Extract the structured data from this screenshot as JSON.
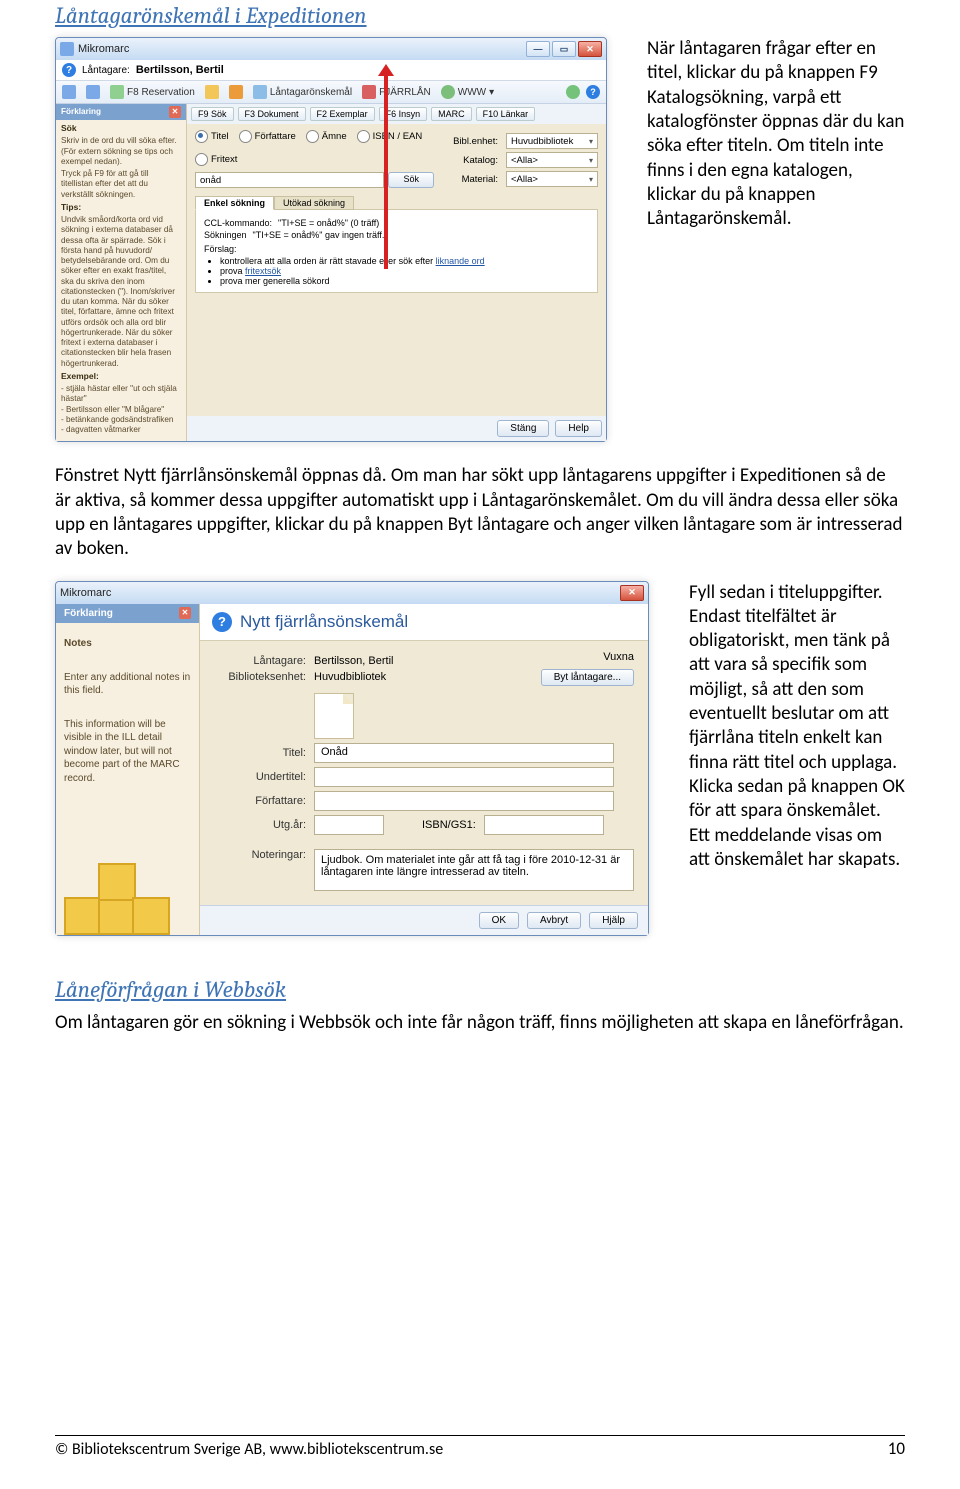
{
  "heading1": "Låntagarönskemål i Expeditionen",
  "intro_text": "När låntagaren frågar efter en titel, klickar du på knappen F9 Katalogsökning, varpå ett katalogfönster öppnas där du kan söka efter titeln. Om titeln inte finns i den egna katalogen, klickar du på knappen Låntagarönskemål.",
  "mm_win": {
    "title": "Mikromarc",
    "borrower_label": "Låntagare:",
    "borrower_name": "Bertilsson, Bertil",
    "toolbar": {
      "back": "",
      "fwd": "",
      "reservation": "F8 Reservation",
      "lock": "",
      "pencil": "",
      "lno": "Låntagarönskemål",
      "fjarrlan": "FJÄRRLÅN",
      "www": "WWW",
      "help": ""
    },
    "side": {
      "head": "Förklaring",
      "sok": "Sök",
      "sok_text": "Skriv in de ord du vill söka efter. (För extern sökning se tips och exempel nedan).",
      "f9": "Tryck på F9 för att gå till titellistan efter det att du verkställt sökningen.",
      "tips_head": "Tips:",
      "tips": "Undvik småord/korta ord vid sökning i externa databaser då dessa ofta är spärrade. Sök i första hand på huvudord/ betydelsebärande ord. Om du söker efter en exakt fras/titel, ska du skriva den inom citationstecken (\"). Inom/skriver du utan komma. När du söker titel, författare, ämne och fritext utförs ordsök och alla ord blir högertrunkerade. När du söker fritext i externa databaser i citationstecken blir hela frasen högertrunkerad.",
      "ex_head": "Exempel:",
      "ex": "- stjäla hästar eller \"ut och stjäla hästar\"\n- Bertilsson eller \"M blågare\"\n- betänkande godsändstrafiken\n- dagvatten våtmarker"
    },
    "fkeys": [
      "F9 Sök",
      "F3 Dokument",
      "F2 Exemplar",
      "F6 Insyn",
      "MARC",
      "F10 Länkar"
    ],
    "radios": {
      "titel": "Titel",
      "forfattare": "Författare",
      "amne": "Ämne",
      "isbn": "ISBN / EAN",
      "fritext": "Fritext"
    },
    "filters": {
      "biblenhet_lbl": "Bibl.enhet:",
      "biblenhet_val": "Huvudbibliotek",
      "katalog_lbl": "Katalog:",
      "katalog_val": "<Alla>",
      "material_lbl": "Material:",
      "material_val": "<Alla>"
    },
    "search_value": "onåd",
    "search_btn": "Sök",
    "tabs": {
      "enkel": "Enkel sökning",
      "utokad": "Utökad sökning"
    },
    "ccl_lbl": "CCL-kommando:",
    "ccl_val": "\"TI+SE = onåd%\" (0 träff)",
    "hits_lbl": "Sökningen",
    "hits_val": "\"TI+SE = onåd%\" gav ingen träff.",
    "forslag_lbl": "Förslag:",
    "forslag_1": "kontrollera att alla orden är rätt stavade eller sök efter",
    "forslag_link1": "liknande ord",
    "forslag_2": "prova",
    "forslag_link2": "fritextsök",
    "forslag_3": "prova mer generella sökord",
    "btn_stang": "Stäng",
    "btn_help": "Help"
  },
  "mid_para": "Fönstret Nytt fjärrlånsönskemål öppnas då. Om man har sökt upp låntagarens uppgifter i Expeditionen så de är aktiva, så kommer dessa uppgifter automatiskt upp i Låntagarönskemålet. Om du vill ändra dessa eller söka upp en låntagares uppgifter, klickar du på knappen Byt låntagare och anger vilken låntagare som är intresserad av boken.",
  "dlg": {
    "win_title": "Mikromarc",
    "side_head": "Förklaring",
    "side_notes": "Notes",
    "side_text1": "Enter any additional notes in this field.",
    "side_text2": "This information will be visible in the ILL detail window later, but will not become part of the MARC record.",
    "banner_title": "Nytt fjärrlånsönskemål",
    "banner_unit": "Vuxna",
    "btn_bytl": "Byt låntagare...",
    "lantagare_lbl": "Låntagare:",
    "lantagare_val": "Bertilsson, Bertil",
    "biblenhet_lbl": "Biblioteksenhet:",
    "biblenhet_val": "Huvudbibliotek",
    "titel_lbl": "Titel:",
    "titel_val": "Onåd",
    "undertitel_lbl": "Undertitel:",
    "undertitel_val": "",
    "forfattare_lbl": "Författare:",
    "forfattare_val": "",
    "utgar_lbl": "Utg.år:",
    "utgar_val": "",
    "isbn_lbl": "ISBN/GS1:",
    "isbn_val": "",
    "notering_lbl": "Noteringar:",
    "notering_val": "Ljudbok. Om materialet inte går att få tag i före 2010-12-31 är låntagaren inte längre intresserad av titeln.",
    "btn_ok": "OK",
    "btn_avbryt": "Avbryt",
    "btn_hjalp": "Hjälp"
  },
  "right_para": "Fyll sedan i titeluppgifter. Endast titelfältet är obligatoriskt, men tänk på att vara så specifik som möjligt, så att den som eventuellt beslutar om att fjärrlåna titeln enkelt kan finna rätt titel och upplaga. Klicka sedan på knappen OK för att spara önskemålet. Ett meddelande visas om att önskemålet har skapats.",
  "heading2": "Låneförfrågan i Webbsök",
  "bottom_para": "Om låntagaren gör en sökning i Webbsök och inte får någon träff, finns möjligheten att skapa en låneförfrågan.",
  "footer_text": "© Bibliotekscentrum Sverige AB, www.bibliotekscentrum.se",
  "page_number": "10"
}
